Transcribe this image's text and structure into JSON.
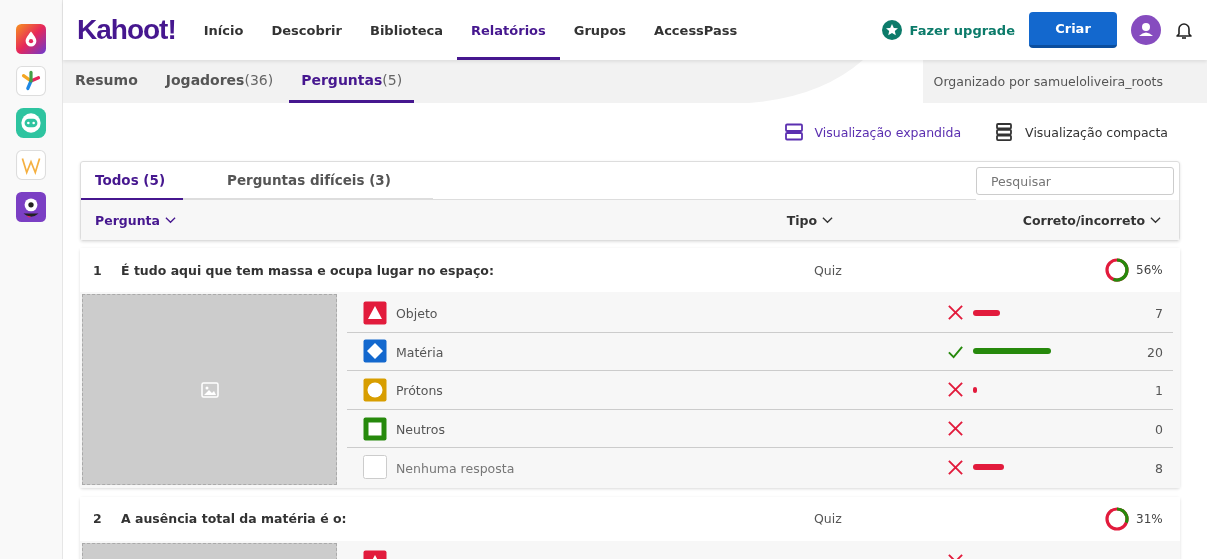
{
  "logo": "Kahoot!",
  "nav": [
    {
      "label": "Início",
      "selected": false
    },
    {
      "label": "Descobrir",
      "selected": false
    },
    {
      "label": "Biblioteca",
      "selected": false
    },
    {
      "label": "Relatórios",
      "selected": true
    },
    {
      "label": "Grupos",
      "selected": false
    },
    {
      "label": "AccessPass",
      "selected": false
    }
  ],
  "upgrade": "Fazer upgrade",
  "create": "Criar",
  "report_tabs": [
    {
      "label": "Resumo",
      "selected": false
    },
    {
      "label": "Jogadores",
      "count": "(36)",
      "selected": false
    },
    {
      "label": "Perguntas",
      "count": "(5)",
      "selected": true
    }
  ],
  "organizer": "Organizado por samueloliveira_roots",
  "view_options": [
    {
      "label": "Visualização expandida",
      "kind": "expanded",
      "selected": true
    },
    {
      "label": "Visualização compacta",
      "kind": "compact",
      "selected": false
    }
  ],
  "filter_tabs": [
    {
      "label": "Todos (5)",
      "selected": true
    },
    {
      "label": "Perguntas difíceis (3)",
      "selected": false
    }
  ],
  "search": {
    "placeholder": "Pesquisar"
  },
  "columns": [
    "Pergunta",
    "Tipo",
    "Correto/incorreto"
  ],
  "questions": [
    {
      "number": "1",
      "text": "É tudo aqui que tem massa e ocupa lugar no espaço:",
      "type": "Quiz",
      "percent": "56%",
      "answers": [
        {
          "kind": "triangle",
          "label": "Objeto",
          "correct": false,
          "count": "7"
        },
        {
          "kind": "diamond",
          "label": "Matéria",
          "correct": true,
          "count": "20"
        },
        {
          "kind": "circle",
          "label": "Prótons",
          "correct": false,
          "count": "1"
        },
        {
          "kind": "square",
          "label": "Neutros",
          "correct": false,
          "count": "0"
        },
        {
          "kind": "none",
          "label": "Nenhuma resposta",
          "correct": false,
          "count": "8"
        }
      ]
    },
    {
      "number": "2",
      "text": "A ausência total da matéria é o:",
      "type": "Quiz",
      "percent": "31%",
      "answers": [
        {
          "kind": "triangle",
          "correct": false
        }
      ]
    }
  ]
}
